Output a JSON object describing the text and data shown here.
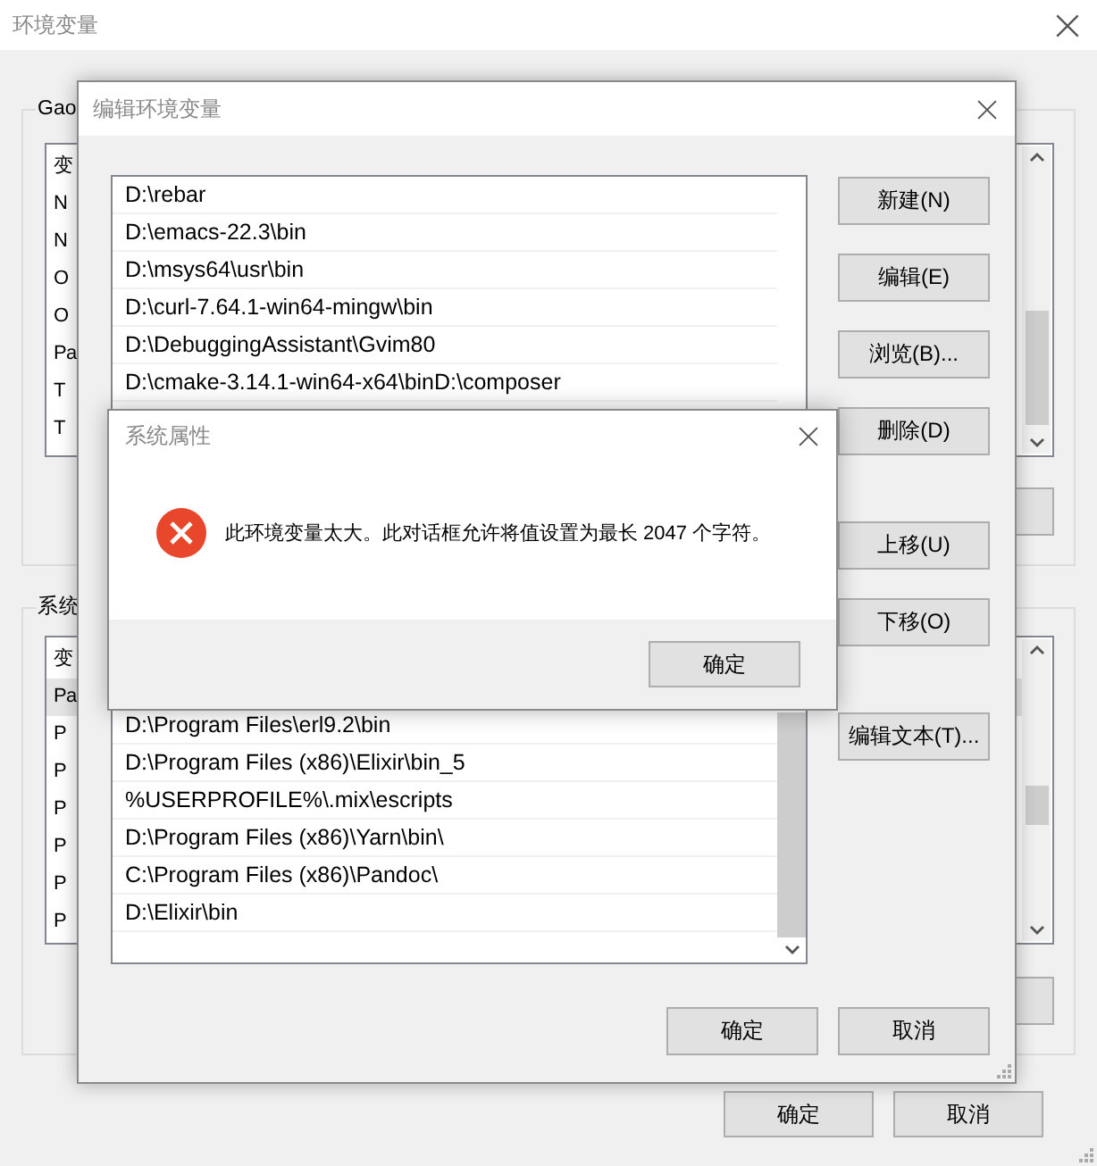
{
  "main_window": {
    "title": "环境变量",
    "user_group": {
      "label": "Gao",
      "column_header": "变",
      "rows": [
        {
          "text": "N",
          "selected": false
        },
        {
          "text": "N",
          "selected": false
        },
        {
          "text": "O",
          "selected": false
        },
        {
          "text": "O",
          "selected": false
        },
        {
          "text": "Pa",
          "selected": false
        },
        {
          "text": "T",
          "selected": false
        },
        {
          "text": "T",
          "selected": false
        }
      ]
    },
    "system_group": {
      "label": "系统",
      "column_header": "变",
      "rows": [
        {
          "text": "Pa",
          "selected": true
        },
        {
          "text": "P",
          "selected": false
        },
        {
          "text": "P",
          "selected": false
        },
        {
          "text": "P",
          "selected": false
        },
        {
          "text": "P",
          "selected": false
        },
        {
          "text": "P",
          "selected": false
        },
        {
          "text": "P",
          "selected": false
        }
      ]
    },
    "buttons": [
      "确定",
      "取消"
    ]
  },
  "edit_dialog": {
    "title": "编辑环境变量",
    "paths_top": [
      "D:\\rebar",
      "D:\\emacs-22.3\\bin",
      "D:\\msys64\\usr\\bin",
      "D:\\curl-7.64.1-win64-mingw\\bin",
      "D:\\DebuggingAssistant\\Gvim80",
      "D:\\cmake-3.14.1-win64-x64\\binD:\\composer"
    ],
    "paths_bottom": [
      "D:\\Program Files\\erl9.2\\bin",
      "D:\\Program Files (x86)\\Elixir\\bin_5",
      "%USERPROFILE%\\.mix\\escripts",
      "D:\\Program Files (x86)\\Yarn\\bin\\",
      "C:\\Program Files (x86)\\Pandoc\\",
      "D:\\Elixir\\bin"
    ],
    "side_button_groups": [
      [
        "新建(N)",
        "编辑(E)",
        "浏览(B)...",
        "删除(D)"
      ],
      [
        "上移(U)",
        "下移(O)"
      ],
      [
        "编辑文本(T)..."
      ]
    ],
    "buttons": [
      "确定",
      "取消"
    ]
  },
  "message_box": {
    "title": "系统属性",
    "icon": {
      "kind": "error"
    },
    "message": "此环境变量太大。此对话框允许将值设置为最长 2047 个字符。",
    "buttons": [
      "确定"
    ]
  }
}
